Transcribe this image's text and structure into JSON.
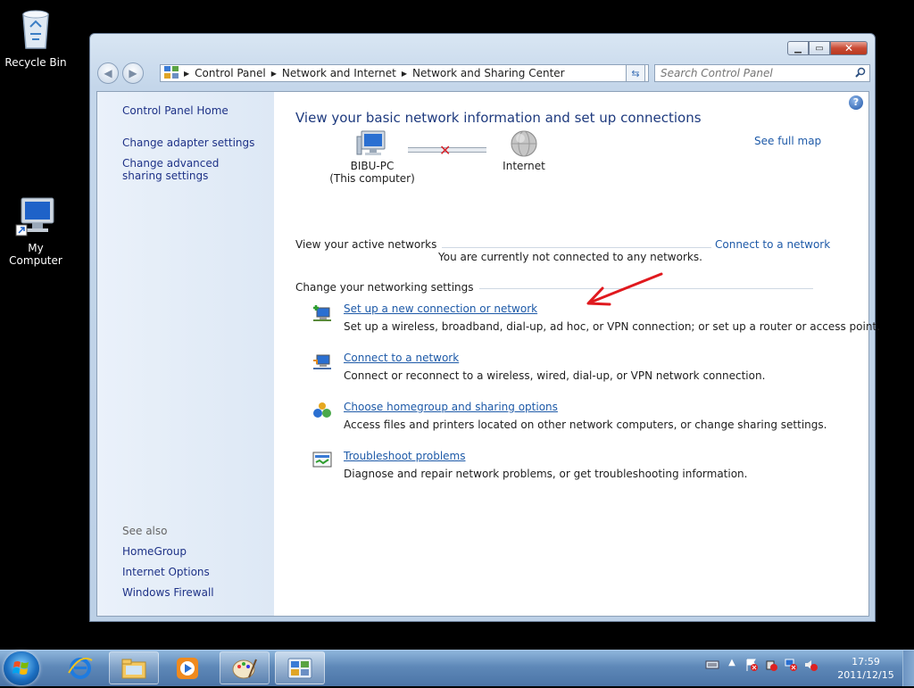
{
  "desktop": {
    "icons": [
      {
        "label": "Recycle Bin"
      },
      {
        "label": "My Computer"
      }
    ]
  },
  "window": {
    "breadcrumb": [
      "Control Panel",
      "Network and Internet",
      "Network and Sharing Center"
    ],
    "search_placeholder": "Search Control Panel",
    "sidebar": {
      "home": "Control Panel Home",
      "links": [
        "Change adapter settings",
        "Change advanced sharing settings"
      ],
      "see_also_title": "See also",
      "see_also": [
        "HomeGroup",
        "Internet Options",
        "Windows Firewall"
      ]
    },
    "main": {
      "heading": "View your basic network information and set up connections",
      "see_full_map": "See full map",
      "computer_name": "BIBU-PC",
      "computer_sub": "(This computer)",
      "internet": "Internet",
      "active_networks_title": "View your active networks",
      "connect_to_network": "Connect to a network",
      "not_connected": "You are currently not connected to any networks.",
      "change_settings_title": "Change your networking settings",
      "tasks": [
        {
          "link": "Set up a new connection or network",
          "desc": "Set up a wireless, broadband, dial-up, ad hoc, or VPN connection; or set up a router or access point."
        },
        {
          "link": "Connect to a network",
          "desc": "Connect or reconnect to a wireless, wired, dial-up, or VPN network connection."
        },
        {
          "link": "Choose homegroup and sharing options",
          "desc": "Access files and printers located on other network computers, or change sharing settings."
        },
        {
          "link": "Troubleshoot problems",
          "desc": "Diagnose and repair network problems, or get troubleshooting information."
        }
      ]
    }
  },
  "taskbar": {
    "time": "17:59",
    "date": "2011/12/15"
  },
  "colors": {
    "link": "#1e5aa8",
    "heading": "#1e3a7e",
    "annotation_arrow": "#e0191e"
  }
}
